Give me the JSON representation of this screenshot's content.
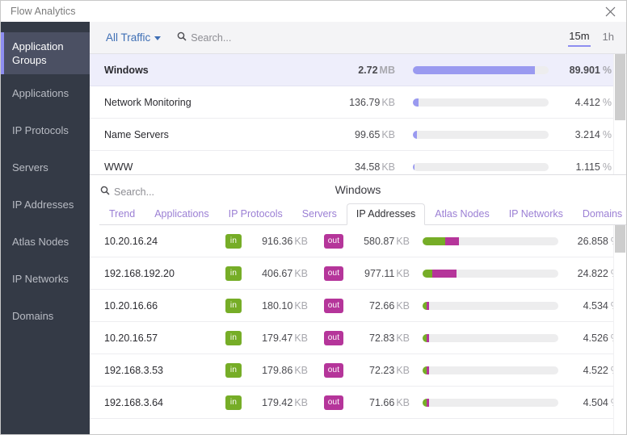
{
  "window": {
    "title": "Flow Analytics",
    "close_icon": "close-icon"
  },
  "sidebar": {
    "items": [
      {
        "label": "Application Groups",
        "active": true
      },
      {
        "label": "Applications",
        "active": false
      },
      {
        "label": "IP Protocols",
        "active": false
      },
      {
        "label": "Servers",
        "active": false
      },
      {
        "label": "IP Addresses",
        "active": false
      },
      {
        "label": "Atlas Nodes",
        "active": false
      },
      {
        "label": "IP Networks",
        "active": false
      },
      {
        "label": "Domains",
        "active": false
      }
    ]
  },
  "toolbar": {
    "traffic_filter": "All Traffic",
    "search_placeholder": "Search...",
    "search_icon": "search-icon",
    "dropdown_icon": "chevron-down-icon",
    "ranges": [
      {
        "label": "15m",
        "active": true
      },
      {
        "label": "1h",
        "active": false
      }
    ]
  },
  "top_table": {
    "bar_color": "#9a9af0",
    "track_color": "#ededee",
    "rows": [
      {
        "name": "Windows",
        "value": "2.72",
        "unit": "MB",
        "pct": "89.901",
        "pct_unit": "%",
        "bar_pct": 89.901,
        "selected": true
      },
      {
        "name": "Network Monitoring",
        "value": "136.79",
        "unit": "KB",
        "pct": "4.412",
        "pct_unit": "%",
        "bar_pct": 4.412,
        "selected": false
      },
      {
        "name": "Name Servers",
        "value": "99.65",
        "unit": "KB",
        "pct": "3.214",
        "pct_unit": "%",
        "bar_pct": 3.214,
        "selected": false
      },
      {
        "name": "WWW",
        "value": "34.58",
        "unit": "KB",
        "pct": "1.115",
        "pct_unit": "%",
        "bar_pct": 1.115,
        "selected": false
      }
    ]
  },
  "detail": {
    "title": "Windows",
    "search_placeholder": "Search...",
    "search_icon": "search-icon",
    "tabs": [
      {
        "label": "Trend",
        "active": false
      },
      {
        "label": "Applications",
        "active": false
      },
      {
        "label": "IP Protocols",
        "active": false
      },
      {
        "label": "Servers",
        "active": false
      },
      {
        "label": "IP Addresses",
        "active": true
      },
      {
        "label": "Atlas Nodes",
        "active": false
      },
      {
        "label": "IP Networks",
        "active": false
      },
      {
        "label": "Domains",
        "active": false
      }
    ],
    "in_badge": "in",
    "out_badge": "out",
    "in_color": "#76ad27",
    "out_color": "#b5359a",
    "rows": [
      {
        "ip": "10.20.16.24",
        "in_value": "916.36",
        "in_unit": "KB",
        "out_value": "580.87",
        "out_unit": "KB",
        "pct": "26.858",
        "pct_unit": "%",
        "in_bar_pct": 16.5,
        "out_bar_pct": 10.4
      },
      {
        "ip": "192.168.192.20",
        "in_value": "406.67",
        "in_unit": "KB",
        "out_value": "977.11",
        "out_unit": "KB",
        "pct": "24.822",
        "pct_unit": "%",
        "in_bar_pct": 7.3,
        "out_bar_pct": 17.5
      },
      {
        "ip": "10.20.16.66",
        "in_value": "180.10",
        "in_unit": "KB",
        "out_value": "72.66",
        "out_unit": "KB",
        "pct": "4.534",
        "pct_unit": "%",
        "in_bar_pct": 3.2,
        "out_bar_pct": 1.3
      },
      {
        "ip": "10.20.16.57",
        "in_value": "179.47",
        "in_unit": "KB",
        "out_value": "72.83",
        "out_unit": "KB",
        "pct": "4.526",
        "pct_unit": "%",
        "in_bar_pct": 3.2,
        "out_bar_pct": 1.3
      },
      {
        "ip": "192.168.3.53",
        "in_value": "179.86",
        "in_unit": "KB",
        "out_value": "72.23",
        "out_unit": "KB",
        "pct": "4.522",
        "pct_unit": "%",
        "in_bar_pct": 3.2,
        "out_bar_pct": 1.3
      },
      {
        "ip": "192.168.3.64",
        "in_value": "179.42",
        "in_unit": "KB",
        "out_value": "71.66",
        "out_unit": "KB",
        "pct": "4.504",
        "pct_unit": "%",
        "in_bar_pct": 3.2,
        "out_bar_pct": 1.3
      }
    ]
  }
}
